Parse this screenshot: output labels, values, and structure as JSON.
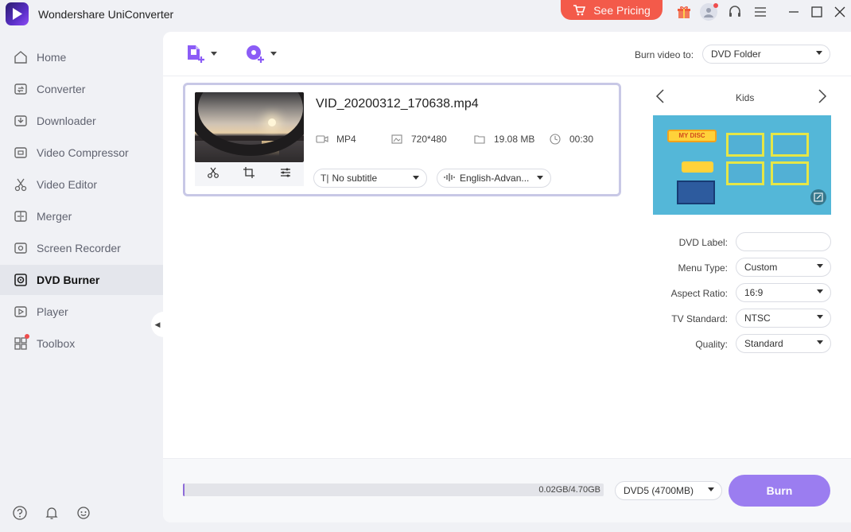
{
  "app": {
    "title": "Wondershare UniConverter",
    "pricing_label": "See Pricing"
  },
  "sidebar": {
    "items": [
      {
        "label": "Home",
        "icon": "home-icon"
      },
      {
        "label": "Converter",
        "icon": "converter-icon"
      },
      {
        "label": "Downloader",
        "icon": "downloader-icon"
      },
      {
        "label": "Video Compressor",
        "icon": "compressor-icon"
      },
      {
        "label": "Video Editor",
        "icon": "scissors-icon"
      },
      {
        "label": "Merger",
        "icon": "merger-icon"
      },
      {
        "label": "Screen Recorder",
        "icon": "screen-recorder-icon"
      },
      {
        "label": "DVD Burner",
        "icon": "dvd-icon",
        "active": true
      },
      {
        "label": "Player",
        "icon": "player-icon"
      },
      {
        "label": "Toolbox",
        "icon": "toolbox-icon"
      }
    ]
  },
  "toolbar": {
    "burn_to_label": "Burn video to:",
    "burn_to_value": "DVD Folder"
  },
  "video": {
    "file_name": "VID_20200312_170638.mp4",
    "format": "MP4",
    "resolution": "720*480",
    "size": "19.08 MB",
    "duration": "00:30",
    "subtitle": "No subtitle",
    "audio": "English-Advan..."
  },
  "template": {
    "name": "Kids",
    "disc_text": "MY DISC"
  },
  "settings": {
    "dvd_label": "DVD Label:",
    "dvd_label_value": "",
    "menu_type_label": "Menu Type:",
    "menu_type_value": "Custom",
    "aspect_label": "Aspect Ratio:",
    "aspect_value": "16:9",
    "tv_label": "TV Standard:",
    "tv_value": "NTSC",
    "quality_label": "Quality:",
    "quality_value": "Standard"
  },
  "footer": {
    "usage_text": "0.02GB/4.70GB",
    "usage_fraction": 0.004,
    "disc_type": "DVD5 (4700MB)",
    "burn_label": "Burn"
  },
  "colors": {
    "accent": "#9b7df0",
    "pricing": "#f35a4a",
    "progress": "#8d6bd9"
  }
}
